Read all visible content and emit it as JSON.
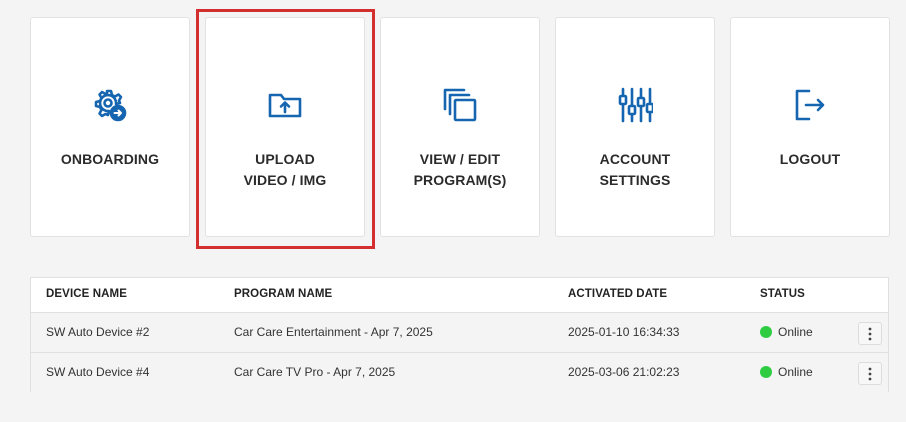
{
  "tiles": [
    {
      "label": "ONBOARDING",
      "icon": "gear-arrow-icon"
    },
    {
      "label": "UPLOAD\nVIDEO / IMG",
      "icon": "folder-upload-icon"
    },
    {
      "label": "VIEW / EDIT\nPROGRAM(S)",
      "icon": "copy-stack-icon"
    },
    {
      "label": "ACCOUNT\nSETTINGS",
      "icon": "sliders-icon"
    },
    {
      "label": "LOGOUT",
      "icon": "logout-icon"
    }
  ],
  "colors": {
    "accent": "#1565b0",
    "highlight": "#d32f2f",
    "online": "#2ecc40"
  },
  "table": {
    "headers": {
      "device_name": "DEVICE NAME",
      "program_name": "PROGRAM NAME",
      "activated_date": "ACTIVATED DATE",
      "status": "STATUS"
    },
    "rows": [
      {
        "device_name": "SW Auto Device #2",
        "program_name": "Car Care Entertainment - Apr 7, 2025",
        "activated_date": "2025-01-10 16:34:33",
        "status": "Online"
      },
      {
        "device_name": "SW Auto Device #4",
        "program_name": "Car Care TV Pro - Apr 7, 2025",
        "activated_date": "2025-03-06 21:02:23",
        "status": "Online"
      }
    ]
  }
}
